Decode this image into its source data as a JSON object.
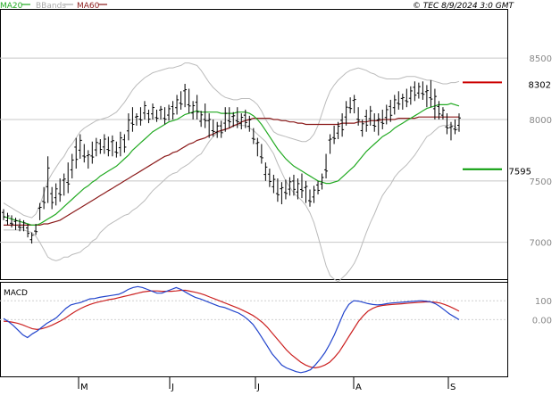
{
  "header": {
    "timestamp": "© TEC 8/9/2024 3:0 GMT",
    "legend": [
      {
        "label": "MA20",
        "color": "#22aa22"
      },
      {
        "label": "BBands",
        "color": "#aaaaaa"
      },
      {
        "label": "MA60",
        "color": "#8b1a1a"
      }
    ]
  },
  "macd_label": "MACD",
  "chart_data": [
    {
      "type": "line",
      "panel": "price",
      "series_kind": "ohlc-bars",
      "x_ticks": [
        "M",
        "J",
        "J",
        "A",
        "S"
      ],
      "y_ticks": [
        "8500",
        "8000",
        "7500",
        "7000"
      ],
      "ylim": [
        6700,
        8900
      ],
      "grid": true,
      "price_bars": [
        [
          7270,
          7180
        ],
        [
          7240,
          7140
        ],
        [
          7220,
          7120
        ],
        [
          7200,
          7100
        ],
        [
          7190,
          7090
        ],
        [
          7180,
          7090
        ],
        [
          7150,
          7040
        ],
        [
          7080,
          6990
        ],
        [
          7150,
          7060
        ],
        [
          7320,
          7180
        ],
        [
          7450,
          7270
        ],
        [
          7700,
          7320
        ],
        [
          7450,
          7270
        ],
        [
          7480,
          7300
        ],
        [
          7520,
          7330
        ],
        [
          7560,
          7380
        ],
        [
          7650,
          7400
        ],
        [
          7720,
          7520
        ],
        [
          7850,
          7600
        ],
        [
          7880,
          7680
        ],
        [
          7800,
          7650
        ],
        [
          7750,
          7600
        ],
        [
          7820,
          7640
        ],
        [
          7850,
          7700
        ],
        [
          7840,
          7720
        ],
        [
          7880,
          7720
        ],
        [
          7860,
          7700
        ],
        [
          7870,
          7700
        ],
        [
          7820,
          7690
        ],
        [
          7900,
          7700
        ],
        [
          7880,
          7730
        ],
        [
          8050,
          7830
        ],
        [
          8100,
          7900
        ],
        [
          8050,
          7950
        ],
        [
          8100,
          7950
        ],
        [
          8150,
          8000
        ],
        [
          8080,
          7970
        ],
        [
          8130,
          8000
        ],
        [
          8080,
          7980
        ],
        [
          8110,
          8000
        ],
        [
          8100,
          7960
        ],
        [
          8120,
          7990
        ],
        [
          8150,
          8000
        ],
        [
          8200,
          8040
        ],
        [
          8230,
          8080
        ],
        [
          8290,
          8100
        ],
        [
          8250,
          8050
        ],
        [
          8150,
          8000
        ],
        [
          8200,
          8000
        ],
        [
          8070,
          7940
        ],
        [
          8130,
          7930
        ],
        [
          8050,
          7850
        ],
        [
          8000,
          7860
        ],
        [
          7980,
          7850
        ],
        [
          7990,
          7850
        ],
        [
          8100,
          7900
        ],
        [
          8100,
          7930
        ],
        [
          8060,
          7940
        ],
        [
          8100,
          7930
        ],
        [
          8050,
          7920
        ],
        [
          8080,
          7930
        ],
        [
          8030,
          7900
        ],
        [
          7930,
          7800
        ],
        [
          7850,
          7700
        ],
        [
          7800,
          7640
        ],
        [
          7650,
          7500
        ],
        [
          7600,
          7450
        ],
        [
          7550,
          7400
        ],
        [
          7520,
          7330
        ],
        [
          7490,
          7310
        ],
        [
          7510,
          7350
        ],
        [
          7530,
          7380
        ],
        [
          7550,
          7380
        ],
        [
          7520,
          7350
        ],
        [
          7560,
          7360
        ],
        [
          7500,
          7320
        ],
        [
          7430,
          7290
        ],
        [
          7460,
          7320
        ],
        [
          7500,
          7390
        ],
        [
          7560,
          7430
        ],
        [
          7720,
          7520
        ],
        [
          7880,
          7720
        ],
        [
          7950,
          7800
        ],
        [
          7980,
          7840
        ],
        [
          8050,
          7860
        ],
        [
          8150,
          7950
        ],
        [
          8180,
          8050
        ],
        [
          8200,
          8050
        ],
        [
          8100,
          7950
        ],
        [
          8000,
          7860
        ],
        [
          8080,
          7900
        ],
        [
          8110,
          7950
        ],
        [
          8050,
          7900
        ],
        [
          8050,
          7870
        ],
        [
          8080,
          7920
        ],
        [
          8120,
          7960
        ],
        [
          8160,
          7980
        ],
        [
          8200,
          8040
        ],
        [
          8230,
          8080
        ],
        [
          8210,
          8080
        ],
        [
          8250,
          8100
        ],
        [
          8270,
          8120
        ],
        [
          8310,
          8150
        ],
        [
          8300,
          8170
        ],
        [
          8310,
          8160
        ],
        [
          8280,
          8100
        ],
        [
          8320,
          8100
        ],
        [
          8250,
          8000
        ],
        [
          8150,
          8000
        ],
        [
          8100,
          8000
        ],
        [
          8050,
          7880
        ],
        [
          7980,
          7830
        ],
        [
          8000,
          7880
        ],
        [
          8050,
          7900
        ]
      ],
      "ma20": [
        7210,
        7200,
        7190,
        7180,
        7170,
        7160,
        7150,
        7140,
        7140,
        7150,
        7170,
        7190,
        7210,
        7230,
        7260,
        7290,
        7320,
        7350,
        7380,
        7410,
        7440,
        7460,
        7490,
        7510,
        7540,
        7560,
        7580,
        7600,
        7620,
        7650,
        7680,
        7710,
        7750,
        7780,
        7810,
        7840,
        7870,
        7900,
        7920,
        7940,
        7960,
        7980,
        7990,
        8000,
        8020,
        8040,
        8050,
        8060,
        8070,
        8060,
        8060,
        8060,
        8060,
        8060,
        8050,
        8050,
        8050,
        8050,
        8060,
        8060,
        8060,
        8050,
        8030,
        8000,
        7960,
        7910,
        7860,
        7810,
        7760,
        7720,
        7680,
        7650,
        7620,
        7600,
        7580,
        7560,
        7540,
        7520,
        7500,
        7490,
        7480,
        7480,
        7490,
        7500,
        7530,
        7560,
        7590,
        7620,
        7660,
        7700,
        7740,
        7770,
        7800,
        7830,
        7860,
        7880,
        7900,
        7930,
        7950,
        7970,
        7990,
        8010,
        8030,
        8050,
        8070,
        8090,
        8100,
        8110,
        8120,
        8120,
        8120,
        8130,
        8120,
        8110
      ],
      "bb_upper": [
        7320,
        7300,
        7280,
        7260,
        7240,
        7220,
        7210,
        7200,
        7230,
        7300,
        7400,
        7500,
        7560,
        7610,
        7660,
        7700,
        7760,
        7800,
        7850,
        7900,
        7930,
        7950,
        7970,
        7990,
        8000,
        8010,
        8020,
        8040,
        8060,
        8100,
        8140,
        8190,
        8240,
        8280,
        8310,
        8340,
        8360,
        8380,
        8390,
        8400,
        8410,
        8420,
        8420,
        8430,
        8440,
        8460,
        8460,
        8450,
        8440,
        8400,
        8350,
        8300,
        8260,
        8230,
        8200,
        8180,
        8170,
        8160,
        8160,
        8170,
        8170,
        8170,
        8150,
        8120,
        8070,
        8000,
        7950,
        7900,
        7880,
        7870,
        7860,
        7850,
        7840,
        7830,
        7820,
        7820,
        7840,
        7880,
        7950,
        8050,
        8150,
        8230,
        8280,
        8320,
        8350,
        8380,
        8400,
        8410,
        8420,
        8410,
        8400,
        8380,
        8370,
        8350,
        8340,
        8330,
        8330,
        8330,
        8330,
        8340,
        8350,
        8350,
        8350,
        8340,
        8330,
        8320,
        8320,
        8310,
        8300,
        8290,
        8290,
        8300,
        8300,
        8310
      ],
      "bb_lower": [
        7100,
        7100,
        7100,
        7100,
        7100,
        7100,
        7090,
        7080,
        7050,
        7000,
        6940,
        6880,
        6860,
        6850,
        6860,
        6880,
        6880,
        6900,
        6910,
        6920,
        6950,
        6970,
        7010,
        7030,
        7080,
        7110,
        7140,
        7160,
        7180,
        7200,
        7220,
        7230,
        7260,
        7280,
        7310,
        7340,
        7380,
        7420,
        7450,
        7480,
        7510,
        7540,
        7560,
        7570,
        7600,
        7620,
        7640,
        7670,
        7700,
        7720,
        7770,
        7820,
        7860,
        7890,
        7900,
        7920,
        7930,
        7940,
        7960,
        7950,
        7950,
        7930,
        7910,
        7880,
        7850,
        7820,
        7770,
        7720,
        7640,
        7570,
        7500,
        7450,
        7400,
        7370,
        7340,
        7300,
        7240,
        7160,
        7050,
        6930,
        6810,
        6730,
        6700,
        6680,
        6710,
        6740,
        6780,
        6830,
        6900,
        6990,
        7080,
        7160,
        7230,
        7310,
        7380,
        7430,
        7470,
        7530,
        7570,
        7600,
        7630,
        7670,
        7710,
        7760,
        7810,
        7860,
        7880,
        7910,
        7940,
        7950,
        7950,
        7960,
        7940,
        7910
      ],
      "ma60": [
        7140,
        7140,
        7140,
        7140,
        7140,
        7140,
        7140,
        7140,
        7140,
        7140,
        7150,
        7150,
        7160,
        7170,
        7180,
        7200,
        7220,
        7240,
        7260,
        7280,
        7300,
        7320,
        7340,
        7360,
        7380,
        7400,
        7420,
        7440,
        7460,
        7480,
        7500,
        7520,
        7540,
        7560,
        7580,
        7600,
        7620,
        7640,
        7660,
        7680,
        7700,
        7710,
        7730,
        7740,
        7760,
        7780,
        7800,
        7810,
        7830,
        7840,
        7850,
        7870,
        7880,
        7900,
        7910,
        7920,
        7930,
        7950,
        7960,
        7980,
        7990,
        8000,
        8010,
        8010,
        8010,
        8010,
        8010,
        8000,
        8000,
        7990,
        7990,
        7980,
        7980,
        7970,
        7970,
        7960,
        7960,
        7960,
        7960,
        7960,
        7960,
        7960,
        7960,
        7960,
        7970,
        7970,
        7970,
        7970,
        7980,
        7980,
        7980,
        7990,
        7990,
        7990,
        8000,
        8000,
        8000,
        8000,
        8010,
        8010,
        8010,
        8010,
        8010,
        8020,
        8020,
        8020,
        8020,
        8020,
        8020,
        8020,
        8020,
        8020,
        8020,
        8020
      ],
      "resistance": {
        "label": "8302",
        "value": 8302,
        "color": "#cc0000"
      },
      "support": {
        "label": "7595",
        "value": 7595,
        "color": "#009900"
      }
    },
    {
      "type": "line",
      "panel": "macd",
      "title": "MACD",
      "y_ticks": [
        "100",
        "0.00"
      ],
      "ylim": [
        -300,
        200
      ],
      "macd": [
        6,
        -10,
        -30,
        -55,
        -80,
        -95,
        -75,
        -60,
        -40,
        -20,
        -5,
        10,
        35,
        60,
        78,
        85,
        90,
        100,
        110,
        112,
        118,
        122,
        126,
        130,
        134,
        145,
        160,
        170,
        175,
        170,
        160,
        150,
        140,
        140,
        150,
        160,
        170,
        160,
        145,
        130,
        118,
        110,
        100,
        90,
        80,
        70,
        65,
        55,
        45,
        35,
        20,
        0,
        -25,
        -60,
        -100,
        -140,
        -180,
        -210,
        -240,
        -255,
        -265,
        -275,
        -280,
        -275,
        -265,
        -240,
        -210,
        -175,
        -130,
        -80,
        -20,
        40,
        80,
        100,
        98,
        92,
        85,
        80,
        78,
        80,
        85,
        88,
        90,
        92,
        94,
        96,
        98,
        100,
        98,
        95,
        85,
        70,
        50,
        30,
        15,
        0
      ],
      "signal": [
        -8,
        -10,
        -14,
        -20,
        -28,
        -38,
        -48,
        -52,
        -48,
        -40,
        -30,
        -18,
        -5,
        10,
        28,
        44,
        58,
        70,
        80,
        88,
        95,
        100,
        106,
        110,
        116,
        122,
        128,
        134,
        140,
        146,
        150,
        152,
        152,
        150,
        150,
        150,
        152,
        155,
        155,
        150,
        145,
        138,
        130,
        120,
        110,
        100,
        90,
        80,
        70,
        60,
        48,
        36,
        22,
        5,
        -15,
        -40,
        -70,
        -100,
        -130,
        -160,
        -185,
        -205,
        -225,
        -240,
        -250,
        -255,
        -250,
        -240,
        -225,
        -200,
        -170,
        -130,
        -90,
        -50,
        -10,
        20,
        45,
        60,
        70,
        75,
        78,
        80,
        82,
        84,
        86,
        88,
        90,
        92,
        94,
        94,
        92,
        88,
        80,
        70,
        58,
        45
      ],
      "colors": {
        "macd": "#2244cc",
        "signal": "#cc2222"
      }
    }
  ]
}
